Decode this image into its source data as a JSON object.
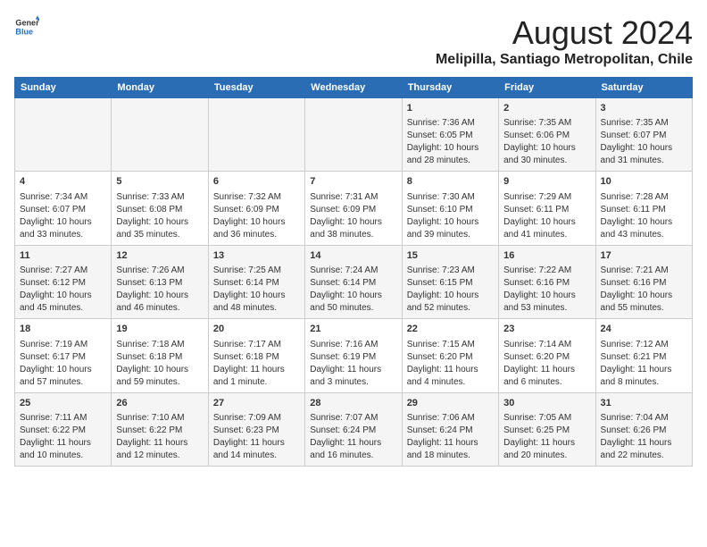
{
  "header": {
    "logo_line1": "General",
    "logo_line2": "Blue",
    "main_title": "August 2024",
    "subtitle": "Melipilla, Santiago Metropolitan, Chile"
  },
  "calendar": {
    "days_of_week": [
      "Sunday",
      "Monday",
      "Tuesday",
      "Wednesday",
      "Thursday",
      "Friday",
      "Saturday"
    ],
    "weeks": [
      [
        {
          "day": "",
          "info": ""
        },
        {
          "day": "",
          "info": ""
        },
        {
          "day": "",
          "info": ""
        },
        {
          "day": "",
          "info": ""
        },
        {
          "day": "1",
          "info": "Sunrise: 7:36 AM\nSunset: 6:05 PM\nDaylight: 10 hours and 28 minutes."
        },
        {
          "day": "2",
          "info": "Sunrise: 7:35 AM\nSunset: 6:06 PM\nDaylight: 10 hours and 30 minutes."
        },
        {
          "day": "3",
          "info": "Sunrise: 7:35 AM\nSunset: 6:07 PM\nDaylight: 10 hours and 31 minutes."
        }
      ],
      [
        {
          "day": "4",
          "info": "Sunrise: 7:34 AM\nSunset: 6:07 PM\nDaylight: 10 hours and 33 minutes."
        },
        {
          "day": "5",
          "info": "Sunrise: 7:33 AM\nSunset: 6:08 PM\nDaylight: 10 hours and 35 minutes."
        },
        {
          "day": "6",
          "info": "Sunrise: 7:32 AM\nSunset: 6:09 PM\nDaylight: 10 hours and 36 minutes."
        },
        {
          "day": "7",
          "info": "Sunrise: 7:31 AM\nSunset: 6:09 PM\nDaylight: 10 hours and 38 minutes."
        },
        {
          "day": "8",
          "info": "Sunrise: 7:30 AM\nSunset: 6:10 PM\nDaylight: 10 hours and 39 minutes."
        },
        {
          "day": "9",
          "info": "Sunrise: 7:29 AM\nSunset: 6:11 PM\nDaylight: 10 hours and 41 minutes."
        },
        {
          "day": "10",
          "info": "Sunrise: 7:28 AM\nSunset: 6:11 PM\nDaylight: 10 hours and 43 minutes."
        }
      ],
      [
        {
          "day": "11",
          "info": "Sunrise: 7:27 AM\nSunset: 6:12 PM\nDaylight: 10 hours and 45 minutes."
        },
        {
          "day": "12",
          "info": "Sunrise: 7:26 AM\nSunset: 6:13 PM\nDaylight: 10 hours and 46 minutes."
        },
        {
          "day": "13",
          "info": "Sunrise: 7:25 AM\nSunset: 6:14 PM\nDaylight: 10 hours and 48 minutes."
        },
        {
          "day": "14",
          "info": "Sunrise: 7:24 AM\nSunset: 6:14 PM\nDaylight: 10 hours and 50 minutes."
        },
        {
          "day": "15",
          "info": "Sunrise: 7:23 AM\nSunset: 6:15 PM\nDaylight: 10 hours and 52 minutes."
        },
        {
          "day": "16",
          "info": "Sunrise: 7:22 AM\nSunset: 6:16 PM\nDaylight: 10 hours and 53 minutes."
        },
        {
          "day": "17",
          "info": "Sunrise: 7:21 AM\nSunset: 6:16 PM\nDaylight: 10 hours and 55 minutes."
        }
      ],
      [
        {
          "day": "18",
          "info": "Sunrise: 7:19 AM\nSunset: 6:17 PM\nDaylight: 10 hours and 57 minutes."
        },
        {
          "day": "19",
          "info": "Sunrise: 7:18 AM\nSunset: 6:18 PM\nDaylight: 10 hours and 59 minutes."
        },
        {
          "day": "20",
          "info": "Sunrise: 7:17 AM\nSunset: 6:18 PM\nDaylight: 11 hours and 1 minute."
        },
        {
          "day": "21",
          "info": "Sunrise: 7:16 AM\nSunset: 6:19 PM\nDaylight: 11 hours and 3 minutes."
        },
        {
          "day": "22",
          "info": "Sunrise: 7:15 AM\nSunset: 6:20 PM\nDaylight: 11 hours and 4 minutes."
        },
        {
          "day": "23",
          "info": "Sunrise: 7:14 AM\nSunset: 6:20 PM\nDaylight: 11 hours and 6 minutes."
        },
        {
          "day": "24",
          "info": "Sunrise: 7:12 AM\nSunset: 6:21 PM\nDaylight: 11 hours and 8 minutes."
        }
      ],
      [
        {
          "day": "25",
          "info": "Sunrise: 7:11 AM\nSunset: 6:22 PM\nDaylight: 11 hours and 10 minutes."
        },
        {
          "day": "26",
          "info": "Sunrise: 7:10 AM\nSunset: 6:22 PM\nDaylight: 11 hours and 12 minutes."
        },
        {
          "day": "27",
          "info": "Sunrise: 7:09 AM\nSunset: 6:23 PM\nDaylight: 11 hours and 14 minutes."
        },
        {
          "day": "28",
          "info": "Sunrise: 7:07 AM\nSunset: 6:24 PM\nDaylight: 11 hours and 16 minutes."
        },
        {
          "day": "29",
          "info": "Sunrise: 7:06 AM\nSunset: 6:24 PM\nDaylight: 11 hours and 18 minutes."
        },
        {
          "day": "30",
          "info": "Sunrise: 7:05 AM\nSunset: 6:25 PM\nDaylight: 11 hours and 20 minutes."
        },
        {
          "day": "31",
          "info": "Sunrise: 7:04 AM\nSunset: 6:26 PM\nDaylight: 11 hours and 22 minutes."
        }
      ]
    ]
  }
}
